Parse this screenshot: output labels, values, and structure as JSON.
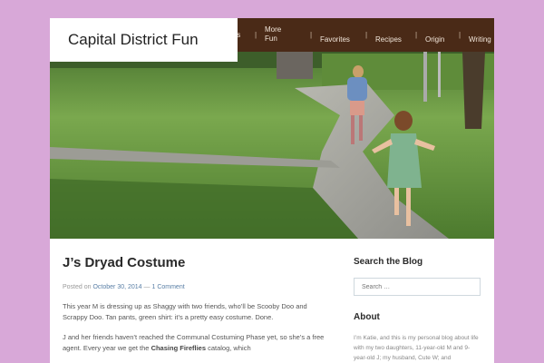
{
  "site": {
    "title": "Capital District Fun"
  },
  "nav": {
    "partial_item": "ts",
    "more_fun_line1": "More",
    "more_fun_line2": "Fun",
    "items": [
      "Favorites",
      "Recipes",
      "Origin",
      "Writing"
    ]
  },
  "post": {
    "title": "J’s Dryad Costume",
    "posted_on_prefix": "Posted on",
    "date": "October 30, 2014",
    "meta_separator": "—",
    "comments": "1 Comment",
    "para1": "This year M is dressing up as Shaggy with two friends, who’ll be Scooby Doo and Scrappy Doo. Tan pants, green shirt: it’s a pretty easy costume. Done.",
    "para2_start": "J and her friends haven’t reached the Communal Costuming Phase yet, so she’s a free agent. Every year we get the ",
    "para2_bold": "Chasing Fireflies",
    "para2_end": " catalog, which"
  },
  "sidebar": {
    "search_title": "Search the Blog",
    "search_placeholder": "Search …",
    "about_title": "About",
    "about_text": "I’m Katie, and this is my personal blog about life with my two daughters, 11-year-old M and 9-year-old J; my husband, Cute W; and"
  },
  "colors": {
    "background": "#d8a8d8",
    "navbar": "#4a2a17",
    "link": "#5a7fa6"
  }
}
